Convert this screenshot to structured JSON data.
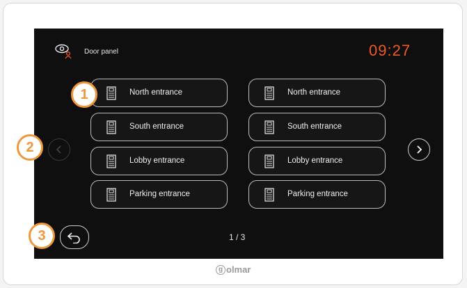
{
  "header": {
    "title": "Door panel",
    "clock": "09:27"
  },
  "entries": [
    {
      "label": "North entrance"
    },
    {
      "label": "North entrance"
    },
    {
      "label": "South entrance"
    },
    {
      "label": "South entrance"
    },
    {
      "label": "Lobby entrance"
    },
    {
      "label": "Lobby entrance"
    },
    {
      "label": "Parking entrance"
    },
    {
      "label": "Parking entrance"
    }
  ],
  "pagination": {
    "indicator": "1 / 3"
  },
  "markers": [
    "1",
    "2",
    "3"
  ],
  "brand": {
    "logo_text": "olmar",
    "logo_initial": "g"
  },
  "colors": {
    "accent": "#f05a28",
    "marker": "#f0963c",
    "screen": "#0f0f0f"
  }
}
